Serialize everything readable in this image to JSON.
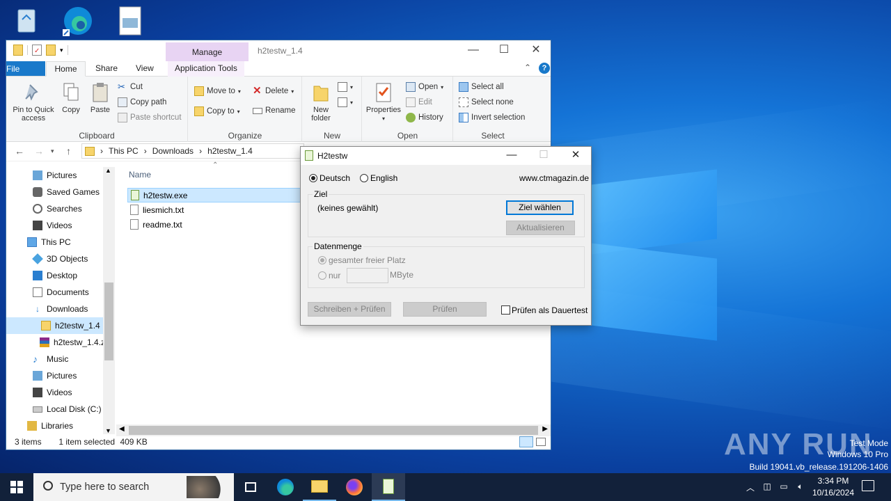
{
  "desktop": {
    "icons": [
      "recycle-bin-icon",
      "edge-icon",
      "image-file-icon"
    ],
    "watermark": {
      "brand": "ANY RUN",
      "line1": "Test Mode",
      "line2": "Windows 10 Pro",
      "line3": "Build 19041.vb_release.191206-1406"
    }
  },
  "explorer": {
    "title": "h2testw_1.4",
    "manage_label": "Manage",
    "tabs": {
      "file": "File",
      "home": "Home",
      "share": "Share",
      "view": "View",
      "app_tools": "Application Tools"
    },
    "ribbon": {
      "clipboard": {
        "label": "Clipboard",
        "pin": "Pin to Quick access",
        "copy": "Copy",
        "paste": "Paste",
        "cut": "Cut",
        "copy_path": "Copy path",
        "paste_shortcut": "Paste shortcut"
      },
      "organize": {
        "label": "Organize",
        "move_to": "Move to",
        "copy_to": "Copy to",
        "delete": "Delete",
        "rename": "Rename"
      },
      "new": {
        "label": "New",
        "new_folder": "New folder"
      },
      "open": {
        "label": "Open",
        "properties": "Properties",
        "open": "Open",
        "edit": "Edit",
        "history": "History"
      },
      "select": {
        "label": "Select",
        "select_all": "Select all",
        "select_none": "Select none",
        "invert": "Invert selection"
      }
    },
    "breadcrumb": [
      "This PC",
      "Downloads",
      "h2testw_1.4"
    ],
    "nav_items": [
      "Pictures",
      "Saved Games",
      "Searches",
      "Videos",
      "This PC",
      "3D Objects",
      "Desktop",
      "Documents",
      "Downloads",
      "h2testw_1.4",
      "h2testw_1.4.z",
      "Music",
      "Pictures",
      "Videos",
      "Local Disk (C:)",
      "Libraries"
    ],
    "column_name": "Name",
    "files": [
      "h2testw.exe",
      "liesmich.txt",
      "readme.txt"
    ],
    "status": {
      "items": "3 items",
      "selected": "1 item selected",
      "size": "409 KB"
    }
  },
  "dialog": {
    "title": "H2testw",
    "lang_de": "Deutsch",
    "lang_en": "English",
    "website": "www.ctmagazin.de",
    "ziel_legend": "Ziel",
    "ziel_value": "(keines gewählt)",
    "btn_ziel": "Ziel wählen",
    "btn_update": "Aktualisieren",
    "datenmenge_legend": "Datenmenge",
    "opt_all": "gesamter freier Platz",
    "opt_only": "nur",
    "unit": "MByte",
    "btn_write": "Schreiben + Prüfen",
    "btn_verify": "Prüfen",
    "chk_endless": "Prüfen als Dauertest"
  },
  "taskbar": {
    "search_placeholder": "Type here to search",
    "time": "3:34 PM",
    "date": "10/16/2024"
  }
}
